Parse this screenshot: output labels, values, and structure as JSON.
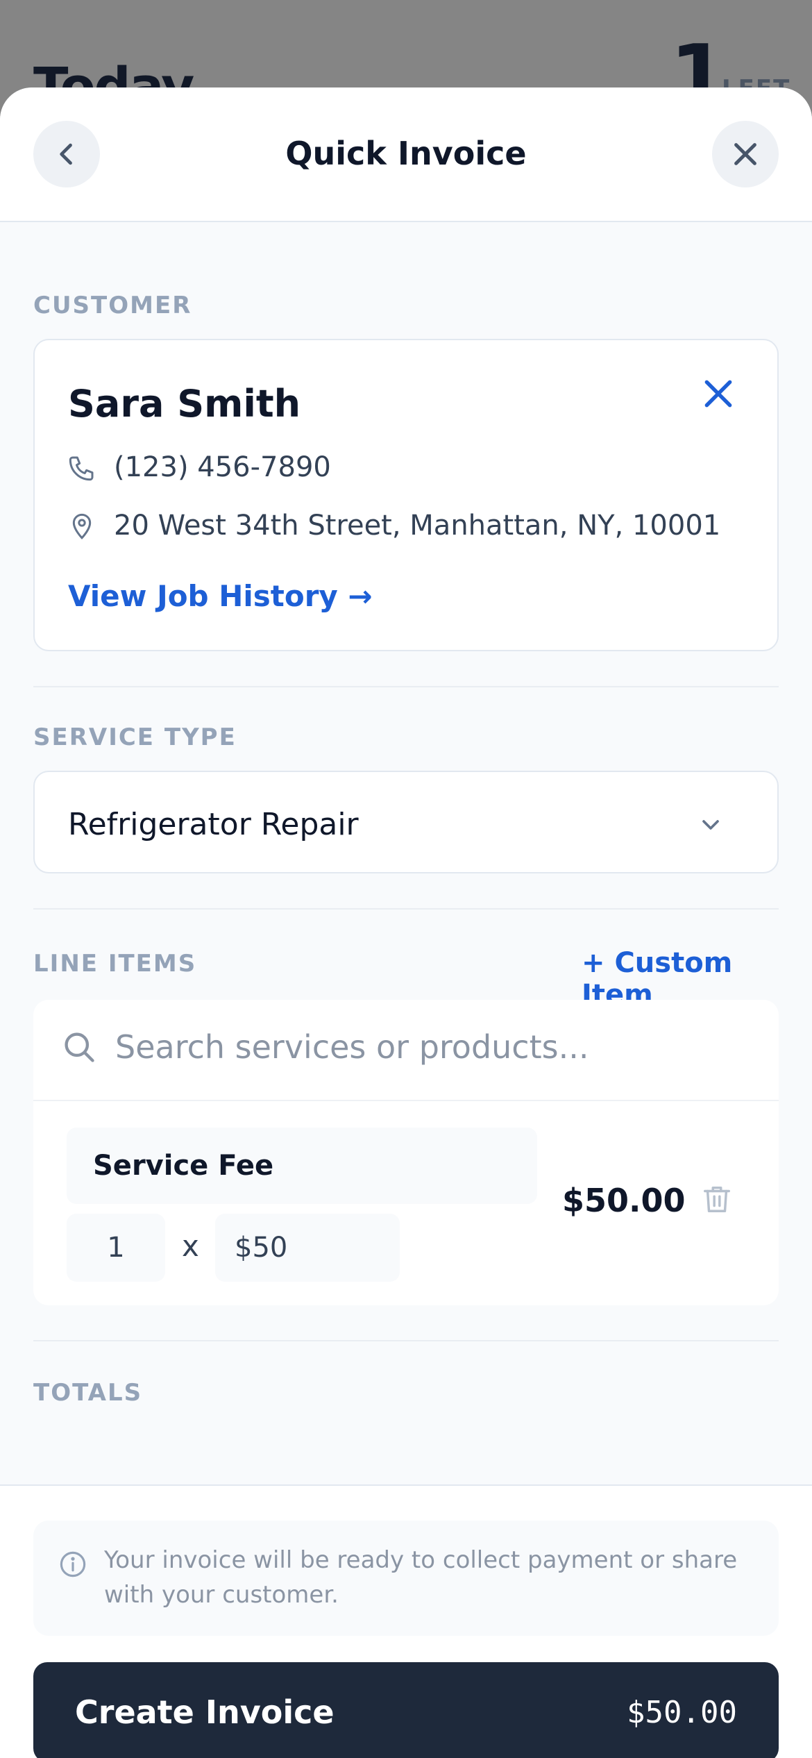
{
  "background": {
    "title": "Today",
    "count": "1",
    "count_label": "LEFT"
  },
  "header": {
    "title": "Quick Invoice",
    "back_icon": "chevron-left-icon",
    "close_icon": "close-icon"
  },
  "customer": {
    "section_label": "CUSTOMER",
    "name": "Sara Smith",
    "phone": "(123) 456-7890",
    "address": "20 West 34th Street, Manhattan, NY, 10001",
    "history_link": "View Job History →"
  },
  "service": {
    "section_label": "SERVICE TYPE",
    "selected": "Refrigerator Repair"
  },
  "line_items": {
    "section_label": "LINE ITEMS",
    "custom_item_label": "+ Custom Item",
    "search_placeholder": "Search services or products...",
    "items": [
      {
        "name": "Service Fee",
        "quantity": "1",
        "multiply": "x",
        "price": "$50",
        "total": "$50.00"
      }
    ]
  },
  "totals": {
    "section_label": "TOTALS"
  },
  "footer": {
    "info_text": "Your invoice will be ready to collect payment or share with your customer.",
    "create_label": "Create Invoice",
    "create_total": "$50.00"
  },
  "colors": {
    "accent": "#1d5fd6",
    "primary_button": "#1e293b",
    "muted": "#94a3b8"
  }
}
